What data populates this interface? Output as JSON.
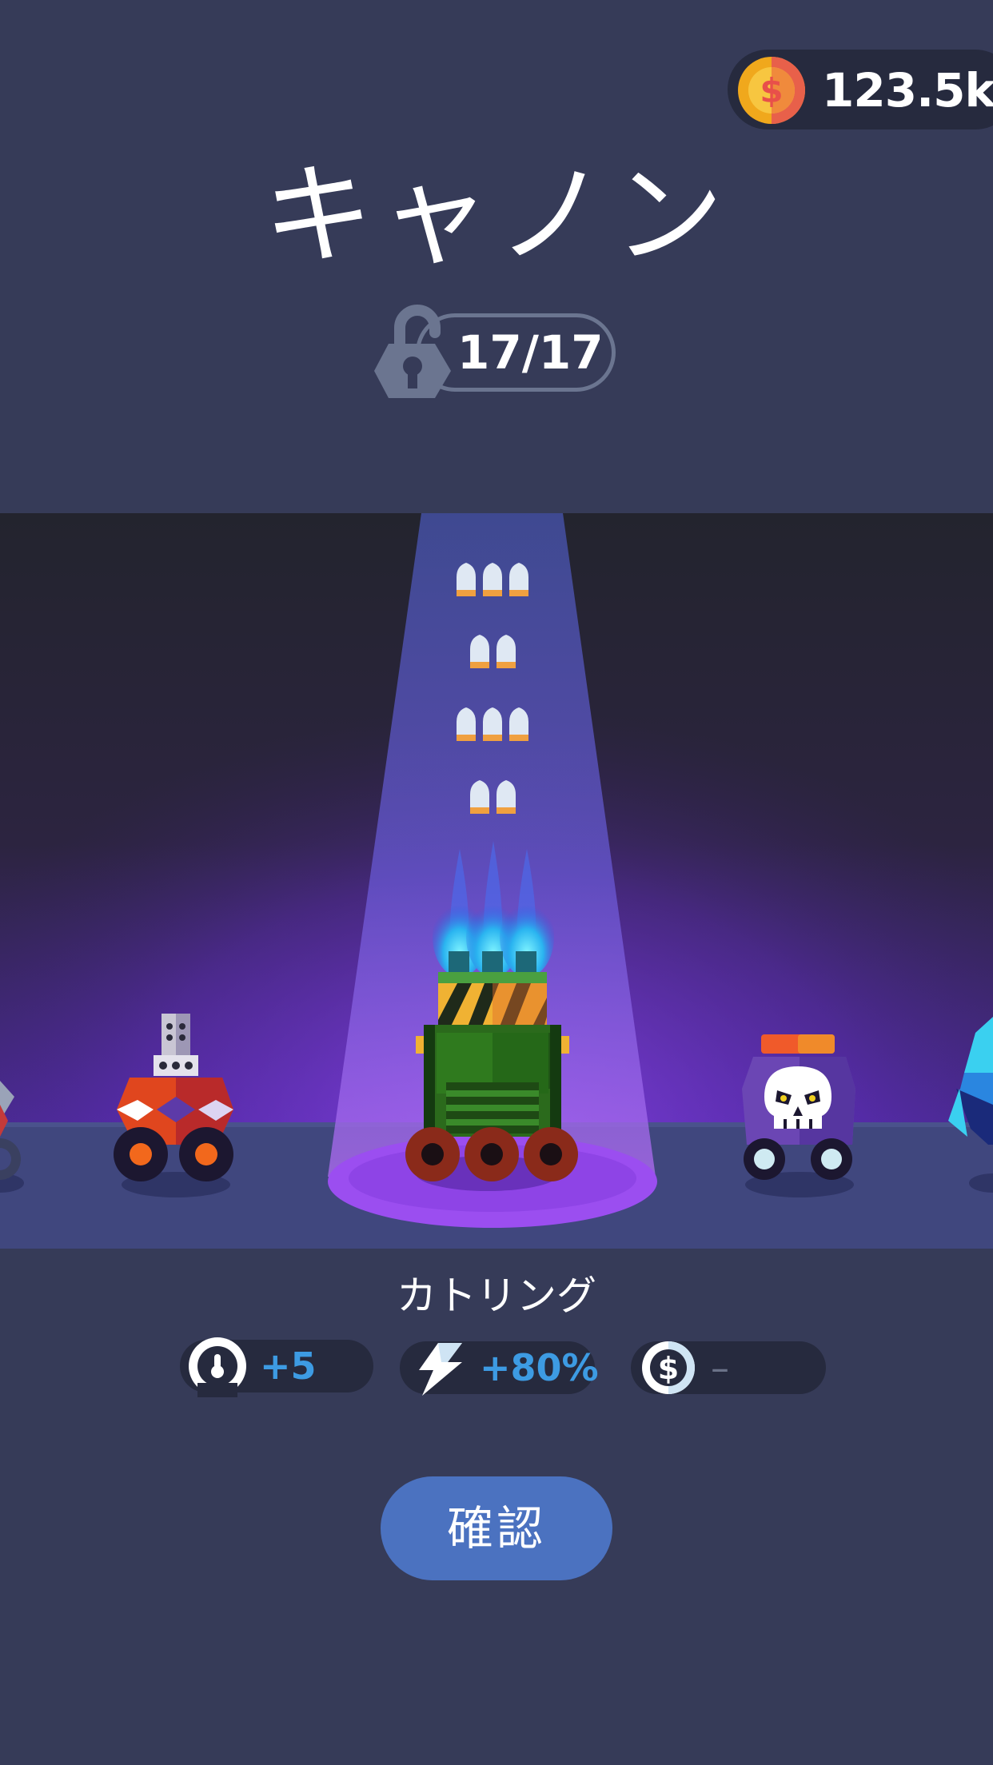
{
  "currency": {
    "amount": "123.5k",
    "icon": "coin-icon"
  },
  "title": "キャノン",
  "unlock": {
    "text": "17/17",
    "icon": "unlock-icon"
  },
  "selected_weapon": {
    "name": "カトリング"
  },
  "stats": [
    {
      "icon": "damage-icon",
      "value": "+5"
    },
    {
      "icon": "lightning-icon",
      "value": "+80%"
    },
    {
      "icon": "coin-bonus-icon",
      "value": "–"
    }
  ],
  "confirm_label": "確認",
  "colors": {
    "background": "#363b58",
    "accent_blue": "#3d9be3",
    "button": "#4b72c0",
    "spotlight_purple": "#8a44e8"
  }
}
